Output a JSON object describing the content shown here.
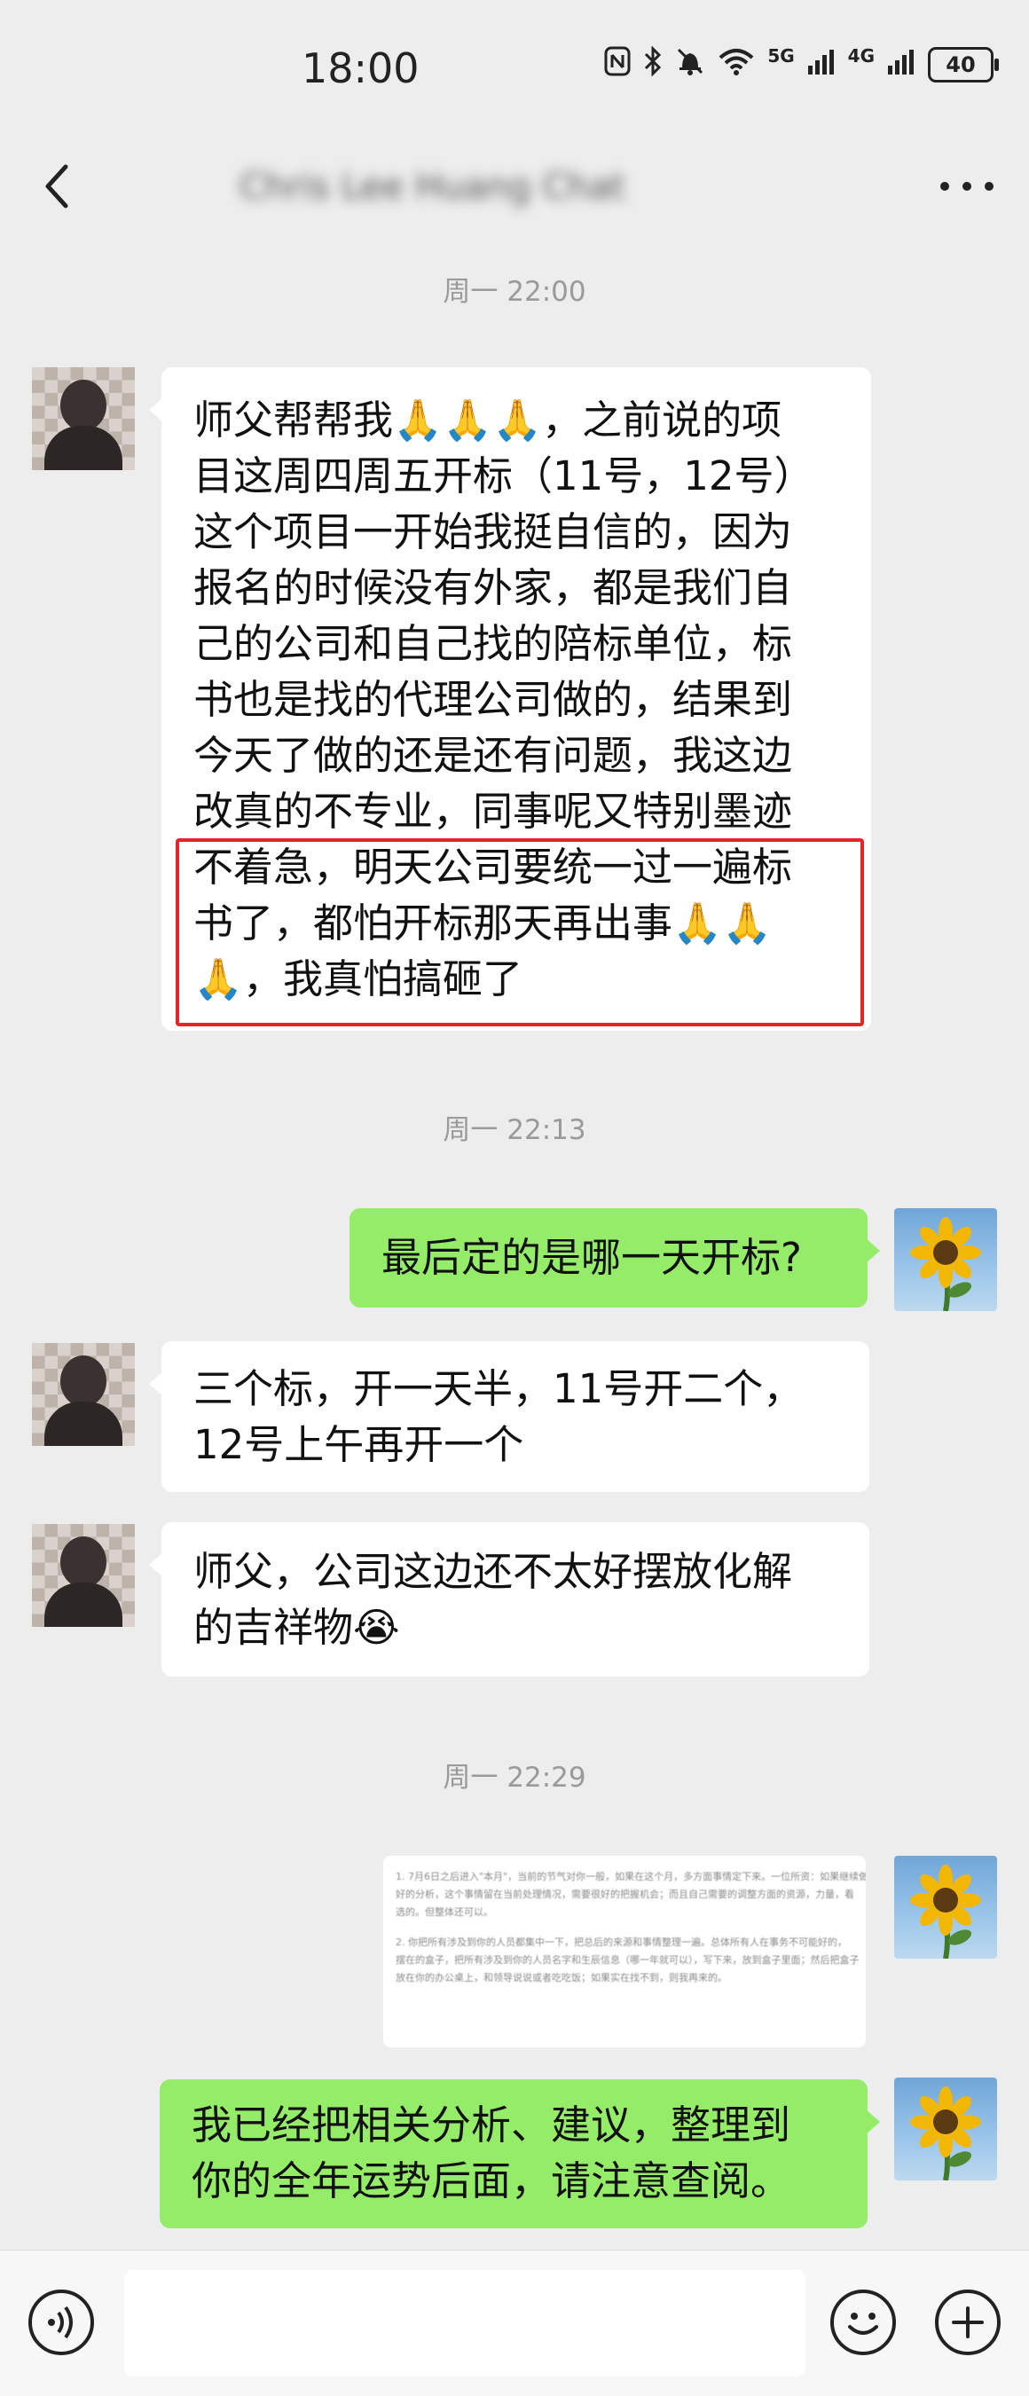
{
  "status_bar": {
    "time": "18:00",
    "signal_5g": "5G",
    "signal_4g": "4G",
    "battery": "40",
    "icons": [
      "nfc-icon",
      "bluetooth-icon",
      "mute-icon",
      "wifi-icon",
      "signal-icon",
      "battery-icon"
    ]
  },
  "header": {
    "title": "Chris Lee Huang Chat",
    "back_icon": "chevron-left-icon",
    "more_icon": "more-dots-icon"
  },
  "messages": [
    {
      "type": "timestamp",
      "text": "周一 22:00"
    },
    {
      "type": "incoming",
      "lines": [
        "师父帮帮我🙏🙏🙏，之前说的项",
        "目这周四周五开标（11号，12号）",
        "这个项目一开始我挺自信的，因为",
        "报名的时候没有外家，都是我们自",
        "己的公司和自己找的陪标单位，标",
        "书也是找的代理公司做的，结果到",
        "今天了做的还是还有问题，我这边",
        "改真的不专业，同事呢又特别墨迹",
        "不着急，明天公司要统一过一遍标",
        "书了，都怕开标那天再出事🙏🙏",
        "🙏，我真怕搞砸了"
      ],
      "highlight_color": "#e8232a"
    },
    {
      "type": "timestamp",
      "text": "周一 22:13"
    },
    {
      "type": "outgoing",
      "lines": [
        "最后定的是哪一天开标?"
      ]
    },
    {
      "type": "incoming",
      "lines": [
        "三个标，开一天半，11号开二个，",
        "12号上午再开一个"
      ]
    },
    {
      "type": "incoming",
      "lines": [
        "师父，公司这边还不太好摆放化解",
        "的吉祥物😭"
      ]
    },
    {
      "type": "timestamp",
      "text": "周一 22:29"
    },
    {
      "type": "outgoing-document",
      "lines": [
        "1. 7月6日之后进入\"本月\"，当前的节气对你一般，如果在这个月，多方面事情定下来。一位所资：如果继续做",
        "好的分析，这个事情留在当前处理情况，需要很好的把握机会；而且自己需要的调整方面的资源，力量，看",
        "选的。但整体还可以。",
        "2. 你把所有涉及到你的人员都集中一下，把总后的来源和事情整理一遍。总体所有人在事务不可能好的，",
        "摆在的盒子，把所有涉及到你的人员名字和生辰信息（哪一年就可以），写下来，放到盒子里面；然后把盒子",
        "放在你的办公桌上，和领导说说或者吃吃饭；如果实在找不到，则我再来的。"
      ]
    },
    {
      "type": "outgoing",
      "lines": [
        "我已经把相关分析、建议，整理到",
        "你的全年运势后面，请注意查阅。"
      ]
    }
  ],
  "input_bar": {
    "placeholder": "",
    "voice_icon": "voice-icon",
    "emoji_icon": "emoji-icon",
    "plus_icon": "plus-icon"
  },
  "colors": {
    "background": "#ededed",
    "incoming_bubble": "#ffffff",
    "outgoing_bubble": "#95ec69",
    "timestamp_text": "#9a9a9a"
  }
}
